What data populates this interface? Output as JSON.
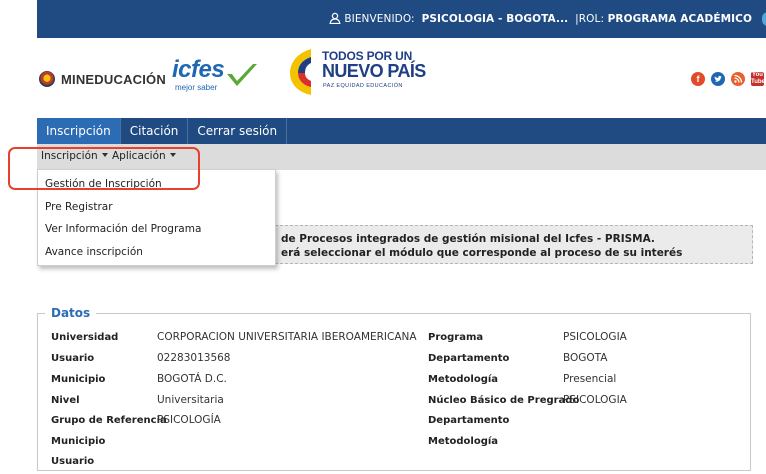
{
  "user_bar": {
    "welcome_label": "BIENVENIDO:",
    "user_name": "PSICOLOGIA - BOGOTA...",
    "role_label": "|ROL:",
    "role_value": "PROGRAMA ACADÉMICO"
  },
  "header": {
    "mineducacion_text": "MINEDUCACIÓN",
    "icfes_text": "icfes",
    "icfes_sub": "mejor saber",
    "campaign_line1": "TODOS POR UN",
    "campaign_line2": "NUEVO PAÍS",
    "campaign_line3": "PAZ  EQUIDAD  EDUCACIÓN",
    "social": {
      "facebook": "f",
      "twitter": "t",
      "rss": "rss",
      "youtube": "You Tube"
    }
  },
  "nav": {
    "items": [
      {
        "label": "Inscripción",
        "active": true
      },
      {
        "label": "Citación",
        "active": false
      },
      {
        "label": "Cerrar sesión",
        "active": false
      }
    ]
  },
  "subnav": {
    "items": [
      {
        "label": "Inscripción"
      },
      {
        "label": "Aplicación"
      }
    ]
  },
  "dropdown": {
    "items": [
      {
        "label": "Gestión de Inscripción"
      },
      {
        "label": "Pre Registrar"
      },
      {
        "label": "Ver Información del Programa"
      },
      {
        "label": "Avance inscripción"
      }
    ]
  },
  "banner": {
    "line1": "de Procesos integrados de gestión misional del Icfes - PRISMA.",
    "line2": "erá seleccionar el módulo que corresponde al proceso de su interés"
  },
  "datos": {
    "legend": "Datos",
    "left": [
      {
        "label": "Universidad",
        "value": "CORPORACION UNIVERSITARIA IBEROAMERICANA"
      },
      {
        "label": "Usuario",
        "value": "02283013568"
      },
      {
        "label": "Municipio",
        "value": "BOGOTÁ D.C."
      },
      {
        "label": "Nivel",
        "value": "Universitaria"
      },
      {
        "label": "Grupo de Referencia",
        "value": "PSICOLOGÍA"
      },
      {
        "label": "Municipio",
        "value": ""
      },
      {
        "label": "Usuario",
        "value": ""
      }
    ],
    "right": [
      {
        "label": "Programa",
        "value": "PSICOLOGIA"
      },
      {
        "label": "Departamento",
        "value": "BOGOTA"
      },
      {
        "label": "Metodología",
        "value": "Presencial"
      },
      {
        "label": "Núcleo Básico de Pregrado",
        "value": "PSICOLOGIA"
      },
      {
        "label": "Departamento",
        "value": ""
      },
      {
        "label": "Metodología",
        "value": ""
      }
    ]
  },
  "colors": {
    "nav_bg": "#1f4a82",
    "nav_active": "#2b6cb5",
    "subnav_bg": "#dcdcdc",
    "highlight": "#e8402a",
    "legend": "#2b6cb5"
  }
}
